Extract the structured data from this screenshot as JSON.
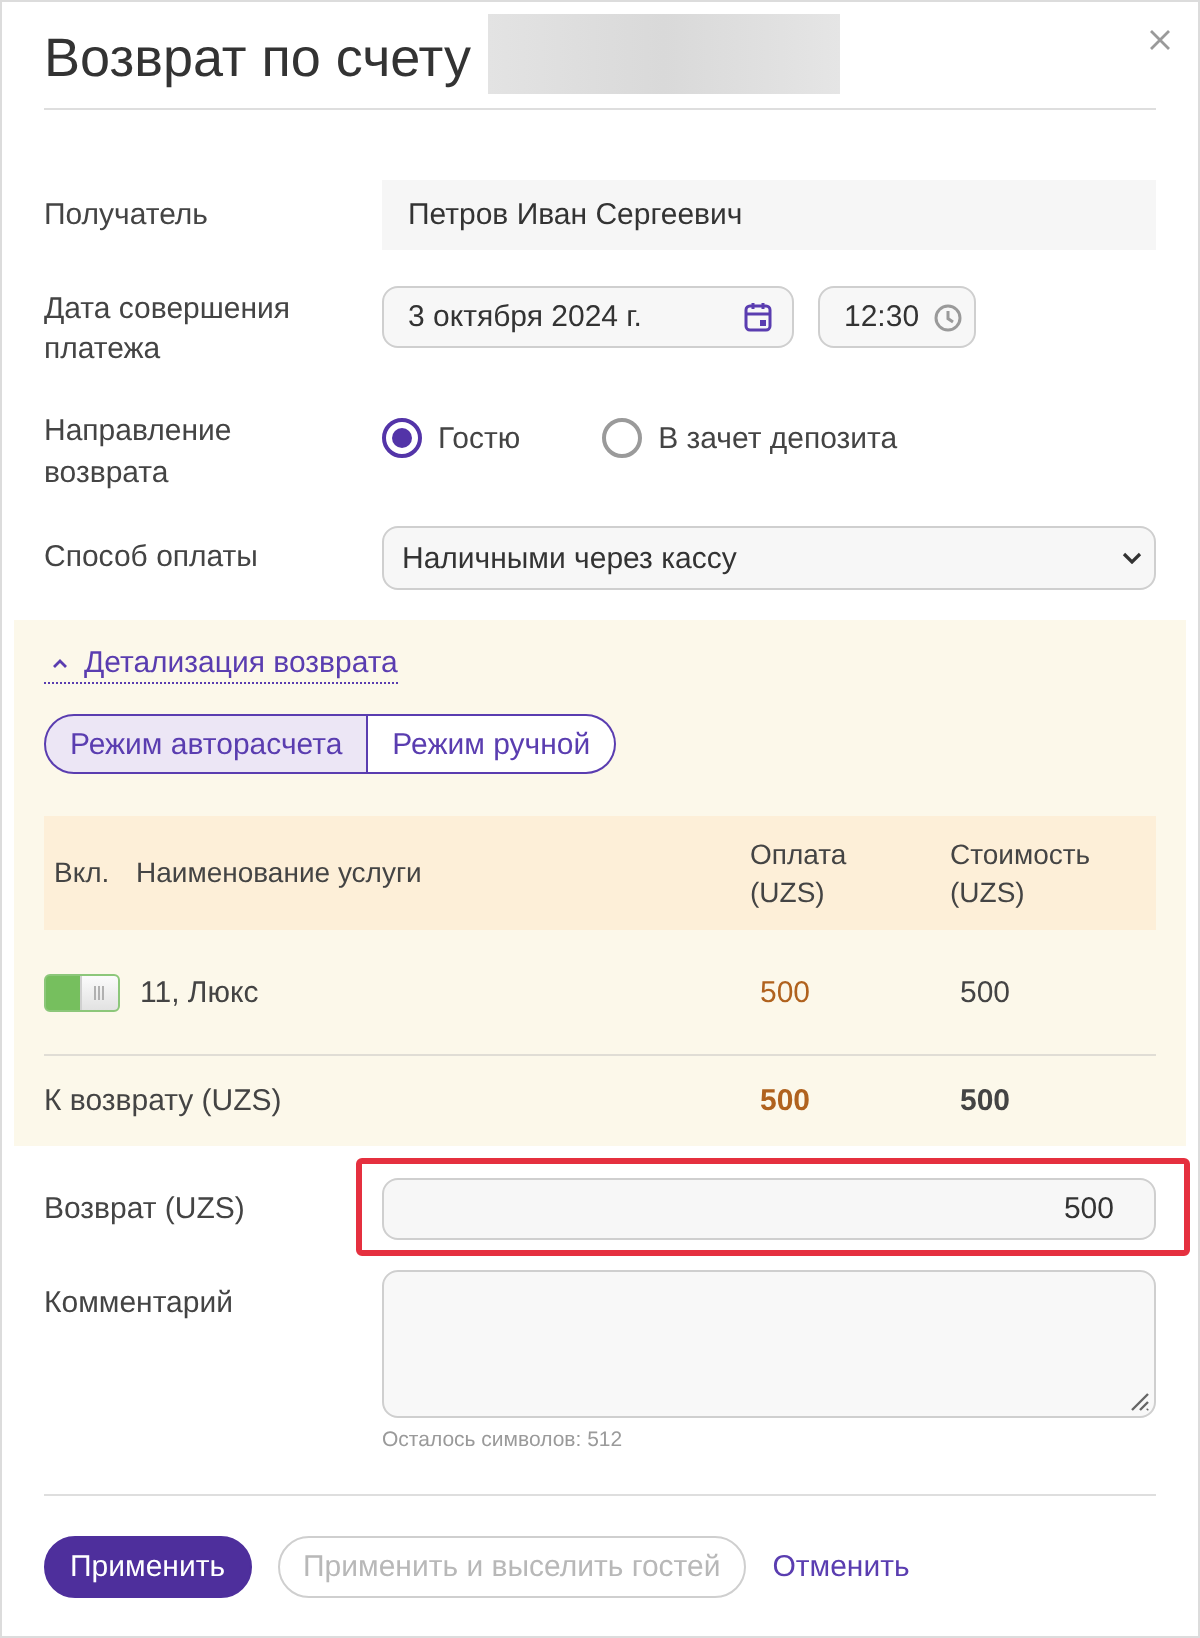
{
  "dialog": {
    "title": "Возврат по счету"
  },
  "form": [
    {
      "kind": "readonly",
      "label": "Получатель",
      "value": "Петров Иван Сергеевич"
    },
    {
      "kind": "datetime",
      "label": "Дата совершения платежа",
      "date": "3 октября 2024 г.",
      "time": "12:30"
    },
    {
      "kind": "radio",
      "label": "Направление возврата",
      "options": [
        {
          "label": "Гостю",
          "selected": true
        },
        {
          "label": "В зачет депозита",
          "selected": false
        }
      ]
    },
    {
      "kind": "select",
      "label": "Способ оплаты",
      "value": "Наличными через кассу"
    }
  ],
  "details": {
    "title": "Детализация возврата",
    "expanded": true,
    "modes": [
      {
        "label": "Режим авторасчета",
        "selected": true
      },
      {
        "label": "Режим ручной",
        "selected": false
      }
    ],
    "table": {
      "columns": [
        "Вкл.",
        "Наименование услуги",
        "Оплата (UZS)",
        "Стоимость (UZS)"
      ],
      "rows": [
        {
          "on": true,
          "service": "11, Люкс",
          "payment": "500",
          "cost": "500"
        }
      ],
      "total": {
        "label": "К возврату (UZS)",
        "payment": "500",
        "cost": "500"
      }
    }
  },
  "refund": {
    "label": "Возврат (UZS)",
    "value": "500",
    "highlighted": true
  },
  "comment": {
    "label": "Комментарий",
    "counter": "Осталось символов: 512"
  },
  "buttons": [
    {
      "kind": "primary",
      "label": "Применить",
      "disabled": false
    },
    {
      "kind": "outline",
      "label": "Применить и выселить гостей",
      "disabled": true
    },
    {
      "kind": "link",
      "label": "Отменить",
      "disabled": false
    }
  ]
}
